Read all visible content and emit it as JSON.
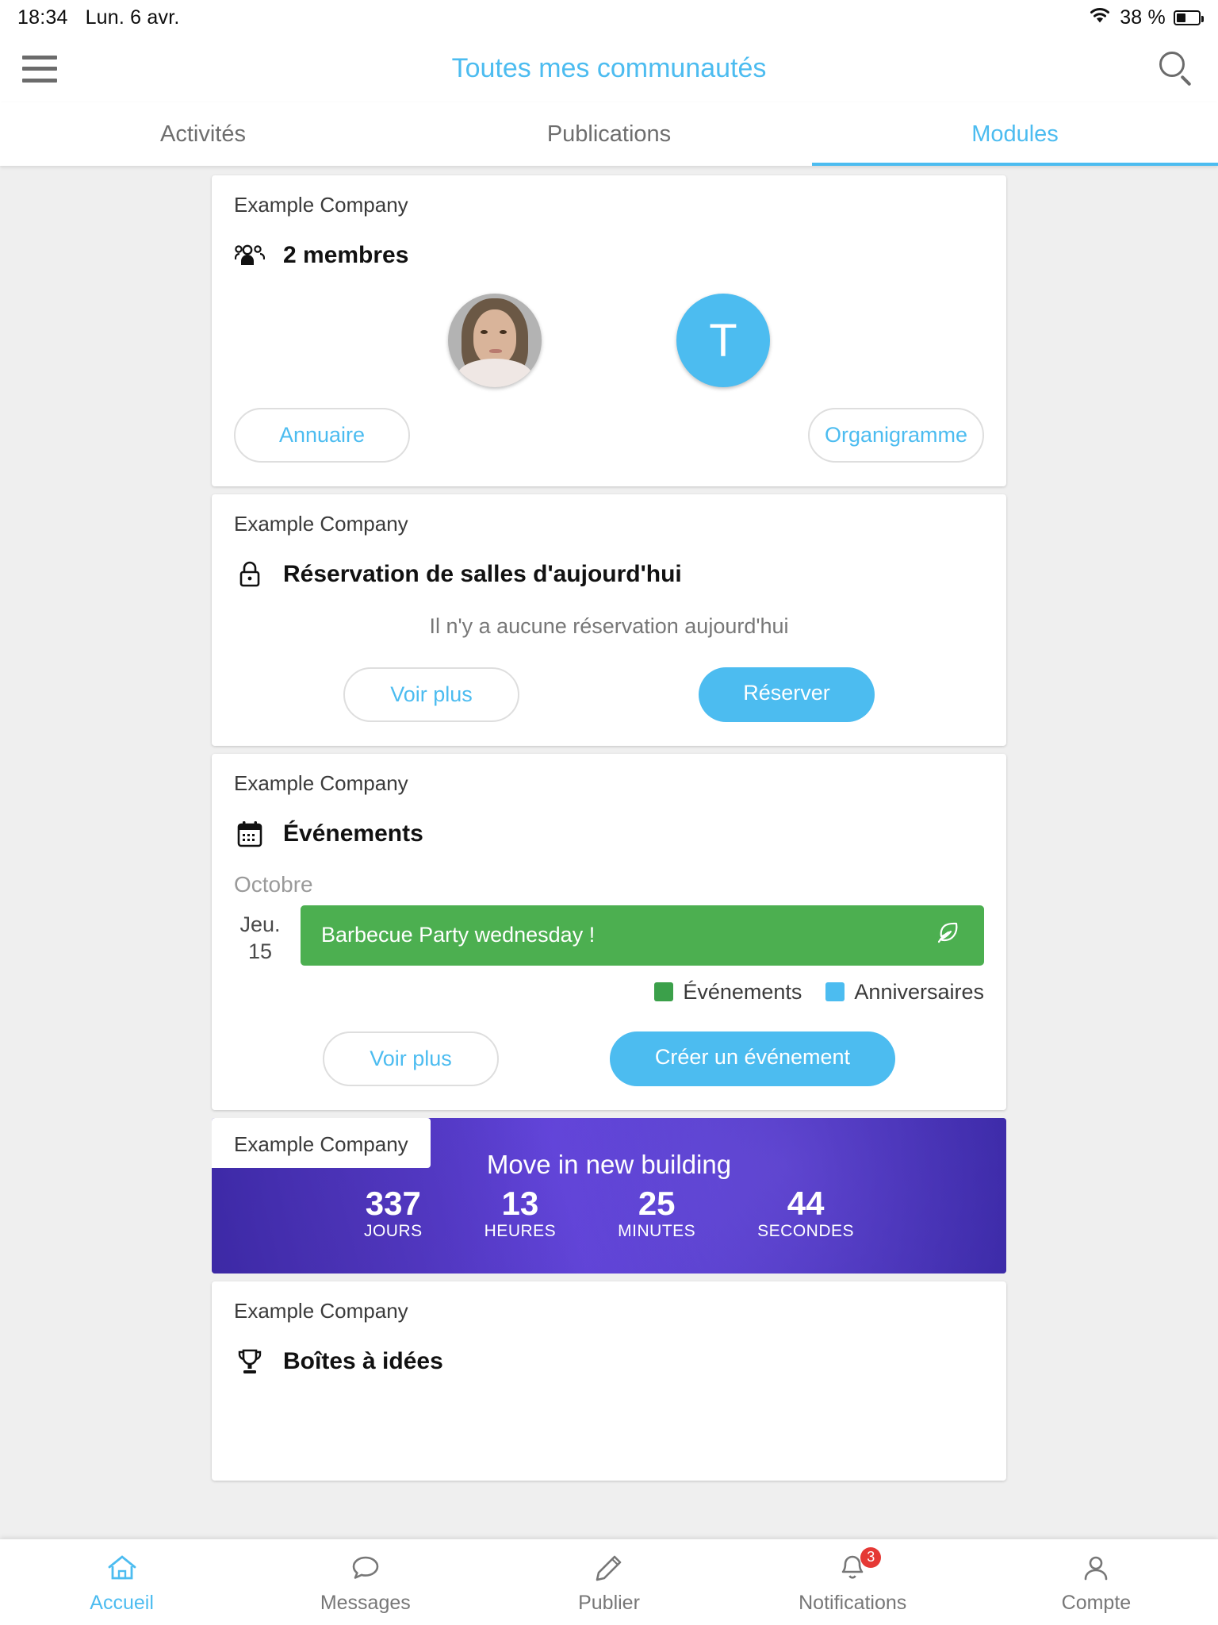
{
  "status_bar": {
    "time": "18:34",
    "date": "Lun. 6 avr.",
    "battery_percent": "38 %",
    "wifi_icon": "wifi-icon",
    "battery_icon": "battery-icon"
  },
  "header": {
    "title": "Toutes mes communautés",
    "menu_icon": "hamburger-menu-icon",
    "search_icon": "search-icon",
    "accent_color": "#4cbcf0"
  },
  "tabs": [
    {
      "label": "Activités",
      "active": false
    },
    {
      "label": "Publications",
      "active": false
    },
    {
      "label": "Modules",
      "active": true
    }
  ],
  "cards": {
    "members": {
      "company": "Example Company",
      "icon": "people-group-icon",
      "title": "2 membres",
      "avatars": [
        {
          "type": "photo",
          "name": "member-avatar-photo"
        },
        {
          "type": "letter",
          "initial": "T",
          "color": "#4cbcf0"
        }
      ],
      "buttons": [
        {
          "label": "Annuaire",
          "style": "outline"
        },
        {
          "label": "Organigramme",
          "style": "outline"
        }
      ]
    },
    "rooms": {
      "company": "Example Company",
      "icon": "lock-icon",
      "title": "Réservation de salles d'aujourd'hui",
      "empty_message": "Il n'y a aucune réservation aujourd'hui",
      "buttons": [
        {
          "label": "Voir plus",
          "style": "outline"
        },
        {
          "label": "Réserver",
          "style": "filled"
        }
      ]
    },
    "events": {
      "company": "Example Company",
      "icon": "calendar-icon",
      "title": "Événements",
      "month": "Octobre",
      "items": [
        {
          "day_name": "Jeu.",
          "day_number": "15",
          "title": "Barbecue Party wednesday !",
          "color": "#4caf50",
          "trailing_icon": "leaf-icon"
        }
      ],
      "legend": [
        {
          "label": "Événements",
          "color": "#3ba04a"
        },
        {
          "label": "Anniversaires",
          "color": "#4cbcf0"
        }
      ],
      "buttons": [
        {
          "label": "Voir plus",
          "style": "outline"
        },
        {
          "label": "Créer un événement",
          "style": "filled"
        }
      ]
    },
    "countdown": {
      "company": "Example Company",
      "title": "Move in new building",
      "units": [
        {
          "value": "337",
          "label": "JOURS"
        },
        {
          "value": "13",
          "label": "HEURES"
        },
        {
          "value": "25",
          "label": "MINUTES"
        },
        {
          "value": "44",
          "label": "SECONDES"
        }
      ]
    },
    "ideas": {
      "company": "Example Company",
      "icon": "trophy-icon",
      "title": "Boîtes à idées"
    }
  },
  "bottom_nav": [
    {
      "label": "Accueil",
      "icon": "home-icon",
      "active": true
    },
    {
      "label": "Messages",
      "icon": "chat-bubble-icon",
      "active": false
    },
    {
      "label": "Publier",
      "icon": "pencil-icon",
      "active": false
    },
    {
      "label": "Notifications",
      "icon": "bell-icon",
      "active": false,
      "badge": "3"
    },
    {
      "label": "Compte",
      "icon": "person-icon",
      "active": false
    }
  ]
}
